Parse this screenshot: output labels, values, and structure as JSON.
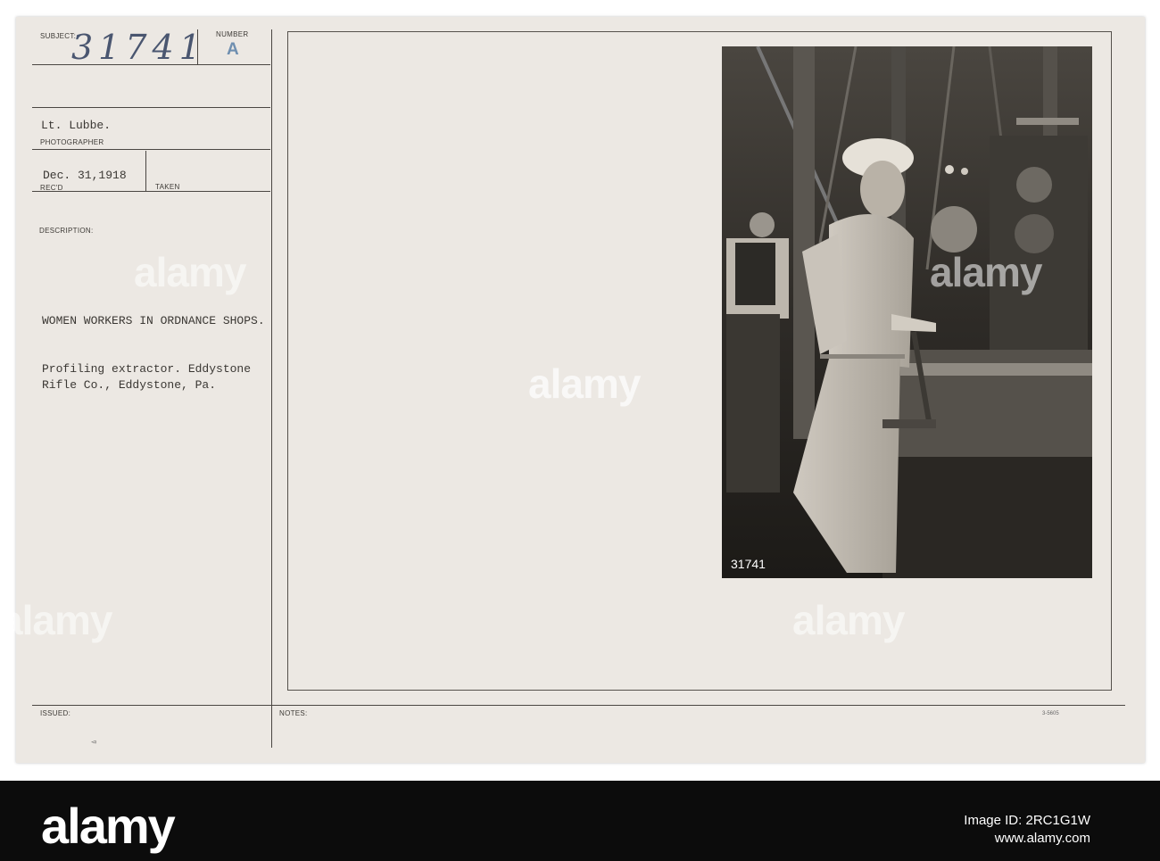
{
  "card": {
    "subject_label": "SUBJECT:",
    "subject_number": "31741",
    "number_label": "NUMBER",
    "number_value": "A",
    "photographer_name": "Lt. Lubbe.",
    "photographer_label": "PHOTOGRAPHER",
    "date": "Dec. 31,1918",
    "recd_label": "REC'D",
    "taken_label": "TAKEN",
    "description_label": "DESCRIPTION:",
    "description_lines": [
      "WOMEN WORKERS IN ORDNANCE SHOPS.",
      "Profiling extractor. Eddystone",
      "Rifle Co., Eddystone, Pa."
    ],
    "issued_label": "ISSUED:",
    "notes_label": "NOTES:",
    "form_number": "3-5605",
    "photo_inscription": "31741"
  },
  "watermark": {
    "text": "alamy"
  },
  "footer": {
    "logo": "alamy",
    "image_id": "Image ID: 2RC1G1W",
    "url": "www.alamy.com"
  },
  "colors": {
    "card_bg": "#ece8e3",
    "ink": "#3b3834",
    "stamp_blue": "#6f8fb0",
    "footer_bg": "#0c0c0c"
  }
}
